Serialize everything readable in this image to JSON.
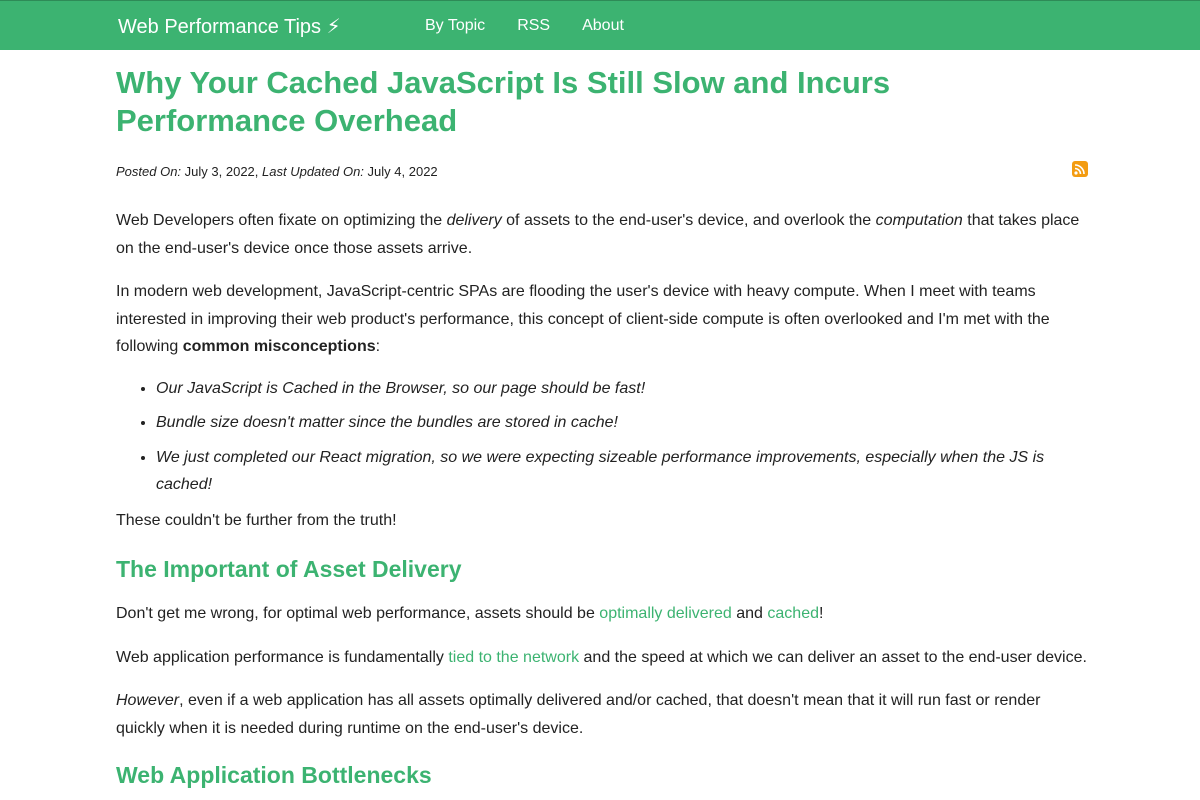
{
  "header": {
    "brand": "Web Performance Tips ⚡",
    "nav": [
      "By Topic",
      "RSS",
      "About"
    ]
  },
  "article": {
    "title": "Why Your Cached JavaScript Is Still Slow and Incurs Performance Overhead",
    "meta": {
      "posted_label": "Posted On:",
      "posted_date": "July 3, 2022,",
      "updated_label": "Last Updated On:",
      "updated_date": "July 4, 2022"
    },
    "p1": {
      "a": "Web Developers often fixate on optimizing the ",
      "b": "delivery",
      "c": " of assets to the end-user's device, and overlook the ",
      "d": "computation",
      "e": " that takes place on the end-user's device once those assets arrive."
    },
    "p2": {
      "a": "In modern web development, JavaScript-centric SPAs are flooding the user's device with heavy compute. When I meet with teams interested in improving their web product's performance, this concept of client-side compute is often overlooked and I'm met with the following ",
      "b": "common misconceptions",
      "c": ":"
    },
    "misconceptions": [
      "Our JavaScript is Cached in the Browser, so our page should be fast!",
      "Bundle size doesn't matter since the bundles are stored in cache!",
      "We just completed our React migration, so we were expecting sizeable performance improvements, especially when the JS is cached!"
    ],
    "p3": "These couldn't be further from the truth!",
    "h2_1": "The Important of Asset Delivery",
    "p4": {
      "a": "Don't get me wrong, for optimal web performance, assets should be ",
      "link1": "optimally delivered",
      "b": " and ",
      "link2": "cached",
      "c": "!"
    },
    "p5": {
      "a": "Web application performance is fundamentally ",
      "link": "tied to the network",
      "b": " and the speed at which we can deliver an asset to the end-user device."
    },
    "p6": {
      "a": "However",
      "b": ", even if a web application has all assets optimally delivered and/or cached, that doesn't mean that it will run fast or render quickly when it is needed during runtime on the end-user's device."
    },
    "h2_2": "Web Application Bottlenecks"
  },
  "icons": {
    "rss": "rss-feed-icon"
  },
  "colors": {
    "accent": "#3cb371",
    "rss": "#f39c12"
  }
}
